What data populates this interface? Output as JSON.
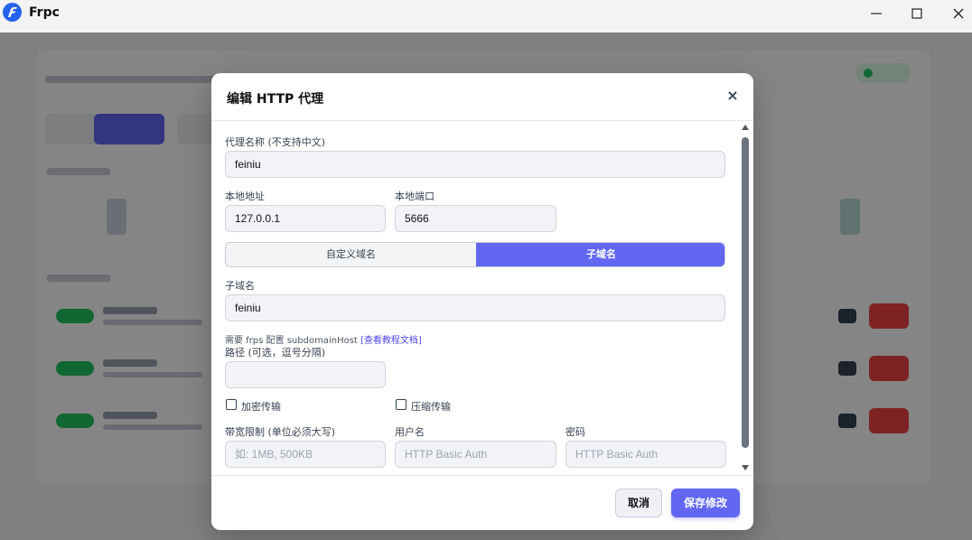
{
  "window": {
    "title": "Frpc",
    "controls": {
      "minimize": "─",
      "maximize": "☐",
      "close": "✕"
    }
  },
  "modal": {
    "title": "编辑 HTTP 代理",
    "close_icon": "×",
    "fields": {
      "proxy_name": {
        "label": "代理名称 (不支持中文)",
        "value": "feiniu"
      },
      "local_addr": {
        "label": "本地地址",
        "value": "127.0.0.1"
      },
      "local_port": {
        "label": "本地端口",
        "value": "5666"
      },
      "domain_mode": {
        "options": [
          "自定义域名",
          "子域名"
        ],
        "selected": "子域名"
      },
      "subdomain": {
        "label": "子域名",
        "value": "feiniu"
      },
      "hint": {
        "text": "需要 frps 配置 subdomainHost ",
        "link": "[查看教程文档]"
      },
      "path": {
        "label": "路径 (可选，逗号分隔)",
        "value": ""
      },
      "encrypt": {
        "label": "加密传输",
        "checked": false
      },
      "compress": {
        "label": "压缩传输",
        "checked": false
      },
      "bandwidth": {
        "label": "带宽限制 (单位必须大写)",
        "placeholder": "如: 1MB, 500KB"
      },
      "username": {
        "label": "用户名",
        "placeholder": "HTTP Basic Auth"
      },
      "password": {
        "label": "密码",
        "placeholder": "HTTP Basic Auth"
      }
    },
    "buttons": {
      "cancel": "取消",
      "save": "保存修改"
    }
  },
  "colors": {
    "accent": "#6366f1",
    "overlay": "rgba(0,0,0,0.48)"
  }
}
